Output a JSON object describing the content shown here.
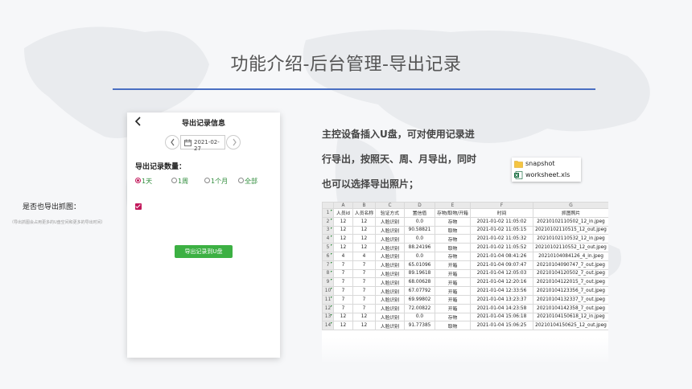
{
  "slide": {
    "title": "功能介绍-后台管理-导出记录",
    "accent_color": "#4a6fc2"
  },
  "phone": {
    "back_icon": "chevron-left-icon",
    "title": "导出记录信息",
    "date": "2021-02-27",
    "count_label": "导出记录数量：",
    "options": [
      "1天",
      "1周",
      "1个月",
      "全部"
    ],
    "selected_option": "1天",
    "photo_label": "是否也导出抓图：",
    "photo_checked": true,
    "hint": "（导出抓图会占用更多的U盘空间和更多的导出时间）",
    "export_button": "导出记录到U盘",
    "button_color": "#3cb043"
  },
  "description": {
    "lines": [
      "主控设备插入U盘，可对使用记录进",
      "行导出，按照天、周、月导出，同时",
      "也可以选择导出照片；"
    ]
  },
  "files": [
    {
      "icon": "folder-icon",
      "name": "snapshot"
    },
    {
      "icon": "excel-file-icon",
      "name": "worksheet.xls"
    }
  ],
  "sheet": {
    "col_letters": [
      "A",
      "B",
      "C",
      "D",
      "E",
      "F",
      "G"
    ],
    "headers": [
      "人员id",
      "人员名称",
      "验证方式",
      "置信值",
      "存物/取物/开箱",
      "时间",
      "抓图照片"
    ],
    "rows": [
      [
        "12",
        "12",
        "人脸识别",
        "0.0",
        "存物",
        "2021-01-02 11:05:02",
        "20210102110502_12_in.jpeg"
      ],
      [
        "12",
        "12",
        "人脸识别",
        "90.58821",
        "取物",
        "2021-01-02 11:05:15",
        "20210102110515_12_out.jpeg"
      ],
      [
        "12",
        "12",
        "人脸识别",
        "0.0",
        "存物",
        "2021-01-02 11:05:32",
        "20210102110532_12_in.jpeg"
      ],
      [
        "12",
        "12",
        "人脸识别",
        "88.24196",
        "取物",
        "2021-01-02 11:05:52",
        "20210102110552_12_out.jpeg"
      ],
      [
        "4",
        "4",
        "人脸识别",
        "0.0",
        "存物",
        "2021-01-04 08:41:26",
        "20210104084126_4_in.jpeg"
      ],
      [
        "7",
        "7",
        "人脸识别",
        "65.01096",
        "开箱",
        "2021-01-04 09:07:47",
        "20210104090747_7_out.jpeg"
      ],
      [
        "7",
        "7",
        "人脸识别",
        "89.19618",
        "开箱",
        "2021-01-04 12:05:03",
        "20210104120502_7_out.jpeg"
      ],
      [
        "7",
        "7",
        "人脸识别",
        "68.00628",
        "开箱",
        "2021-01-04 12:20:16",
        "20210104122015_7_out.jpeg"
      ],
      [
        "7",
        "7",
        "人脸识别",
        "67.07792",
        "开箱",
        "2021-01-04 12:33:56",
        "20210104123356_7_out.jpeg"
      ],
      [
        "7",
        "7",
        "人脸识别",
        "69.99802",
        "开箱",
        "2021-01-04 13:23:37",
        "20210104132337_7_out.jpeg"
      ],
      [
        "7",
        "7",
        "人脸识别",
        "72.00822",
        "开箱",
        "2021-01-04 14:23:58",
        "20210104142358_7_out.jpeg"
      ],
      [
        "12",
        "12",
        "人脸识别",
        "0.0",
        "存物",
        "2021-01-04 15:06:18",
        "20210104150618_12_in.jpeg"
      ],
      [
        "12",
        "12",
        "人脸识别",
        "91.77385",
        "取物",
        "2021-01-04 15:06:25",
        "20210104150625_12_out.jpeg"
      ]
    ]
  }
}
